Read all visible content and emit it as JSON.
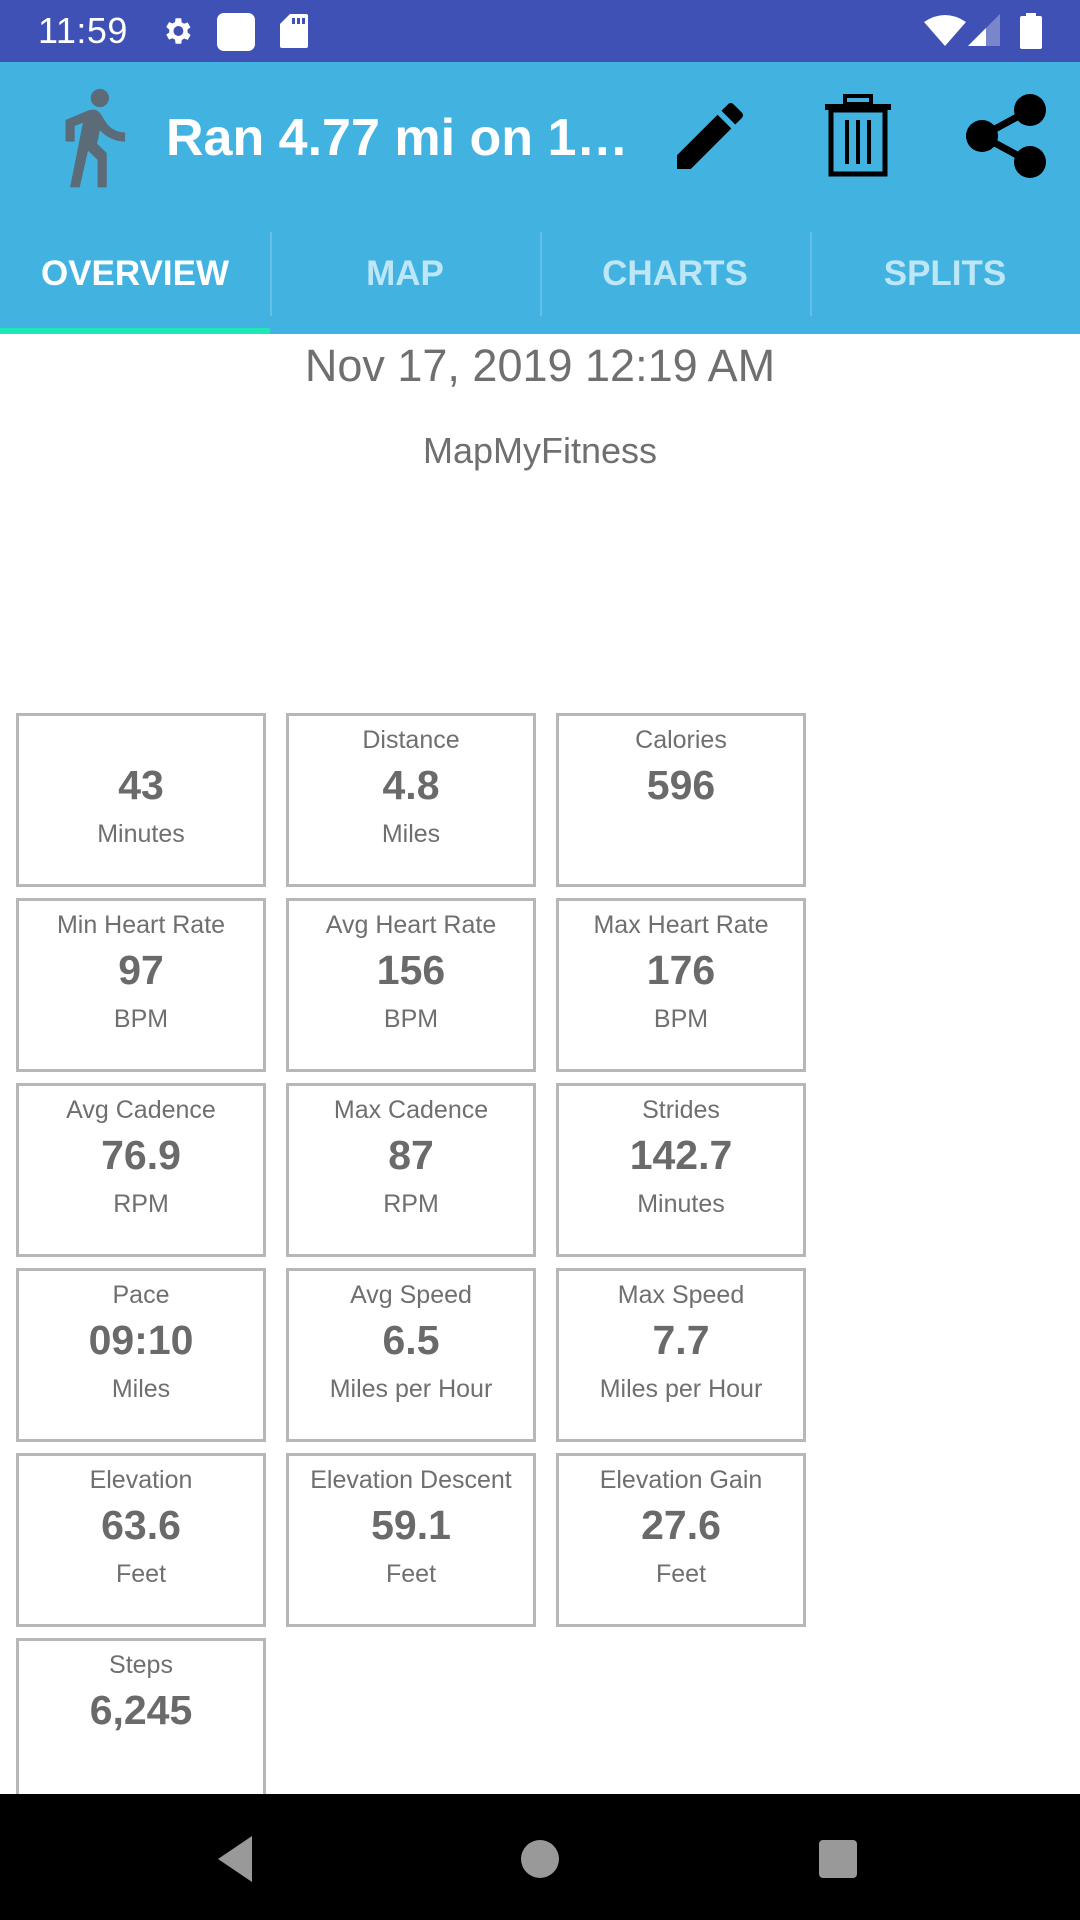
{
  "status_bar": {
    "time": "11:59",
    "left_icons": [
      "gear-icon",
      "square-notification-icon",
      "sd-card-icon"
    ],
    "right_icons": [
      "wifi-icon",
      "cell-signal-icon",
      "battery-icon"
    ]
  },
  "app_bar": {
    "logo_icon": "running-person-icon",
    "title": "Ran 4.77 mi on 1…",
    "actions": [
      {
        "name": "edit",
        "icon": "pencil-icon"
      },
      {
        "name": "delete",
        "icon": "trash-icon"
      },
      {
        "name": "share",
        "icon": "share-icon"
      }
    ]
  },
  "tabs": [
    {
      "label": "OVERVIEW",
      "active": true
    },
    {
      "label": "MAP",
      "active": false
    },
    {
      "label": "CHARTS",
      "active": false
    },
    {
      "label": "SPLITS",
      "active": false
    }
  ],
  "overview": {
    "date": "Nov 17, 2019 12:19 AM",
    "source": "MapMyFitness",
    "stats": [
      {
        "label": "",
        "value": "43",
        "unit": "Minutes"
      },
      {
        "label": "Distance",
        "value": "4.8",
        "unit": "Miles"
      },
      {
        "label": "Calories",
        "value": "596",
        "unit": ""
      },
      {
        "label": "Min Heart Rate",
        "value": "97",
        "unit": "BPM"
      },
      {
        "label": "Avg Heart Rate",
        "value": "156",
        "unit": "BPM"
      },
      {
        "label": "Max Heart Rate",
        "value": "176",
        "unit": "BPM"
      },
      {
        "label": "Avg Cadence",
        "value": "76.9",
        "unit": "RPM"
      },
      {
        "label": "Max Cadence",
        "value": "87",
        "unit": "RPM"
      },
      {
        "label": "Strides",
        "value": "142.7",
        "unit": "Minutes"
      },
      {
        "label": "Pace",
        "value": "09:10",
        "unit": "Miles"
      },
      {
        "label": "Avg Speed",
        "value": "6.5",
        "unit": "Miles per Hour"
      },
      {
        "label": "Max Speed",
        "value": "7.7",
        "unit": "Miles per Hour"
      },
      {
        "label": "Elevation",
        "value": "63.6",
        "unit": "Feet"
      },
      {
        "label": "Elevation Descent",
        "value": "59.1",
        "unit": "Feet"
      },
      {
        "label": "Elevation Gain",
        "value": "27.6",
        "unit": "Feet"
      },
      {
        "label": "Steps",
        "value": "6,245",
        "unit": ""
      }
    ]
  },
  "nav_bar": {
    "buttons": [
      "back-icon",
      "home-icon",
      "recents-icon"
    ]
  },
  "colors": {
    "status_bar": "#3F51B5",
    "app_bar": "#42B3E1",
    "tab_indicator": "#1DE9B6",
    "text_gray": "#6f6f6f",
    "card_border": "#b7b7b7"
  }
}
